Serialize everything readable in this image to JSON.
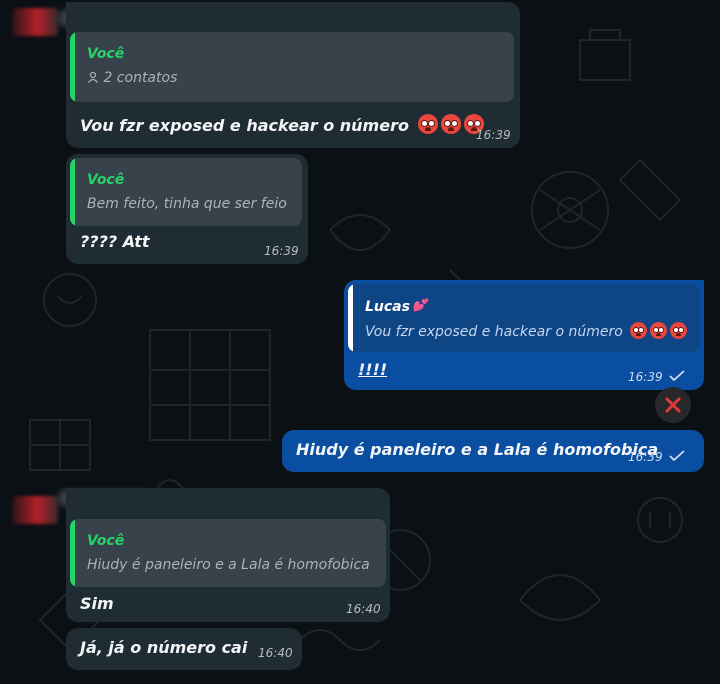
{
  "messages": [
    {
      "quote_author": "Você",
      "quote_text": "2 contatos",
      "quote_icon": "contact-icon",
      "text": "Vou fzr exposed e hackear o número",
      "emoji": "hot-face-emoji",
      "time": "16:39"
    },
    {
      "quote_author": "Você",
      "quote_text": "Bem feito, tinha que ser feio",
      "text": "???? Att",
      "time": "16:39"
    },
    {
      "quote_author": "Lucas",
      "quote_author_emoji": "two-hearts-emoji",
      "quote_text": "Vou fzr exposed e hackear o número",
      "text": "!!!!",
      "time": "16:39",
      "status": "sent-tick"
    },
    {
      "text": "Hiudy é paneleiro e a Lala é homofobica",
      "time": "16:39",
      "status": "sent-tick"
    },
    {
      "quote_author": "Você",
      "quote_text": "Hiudy é paneleiro e a Lala é homofobica",
      "text": "Sim",
      "time": "16:40"
    },
    {
      "text": "Já, já o número cai",
      "time": "16:40"
    }
  ],
  "colors": {
    "background": "#0b1014",
    "incoming_bubble": "#202c33",
    "outgoing_bubble": "#0a4ea1",
    "quote_bar_you": "#25d366",
    "quote_author_you": "#25d366",
    "error_icon": "#e53935"
  }
}
